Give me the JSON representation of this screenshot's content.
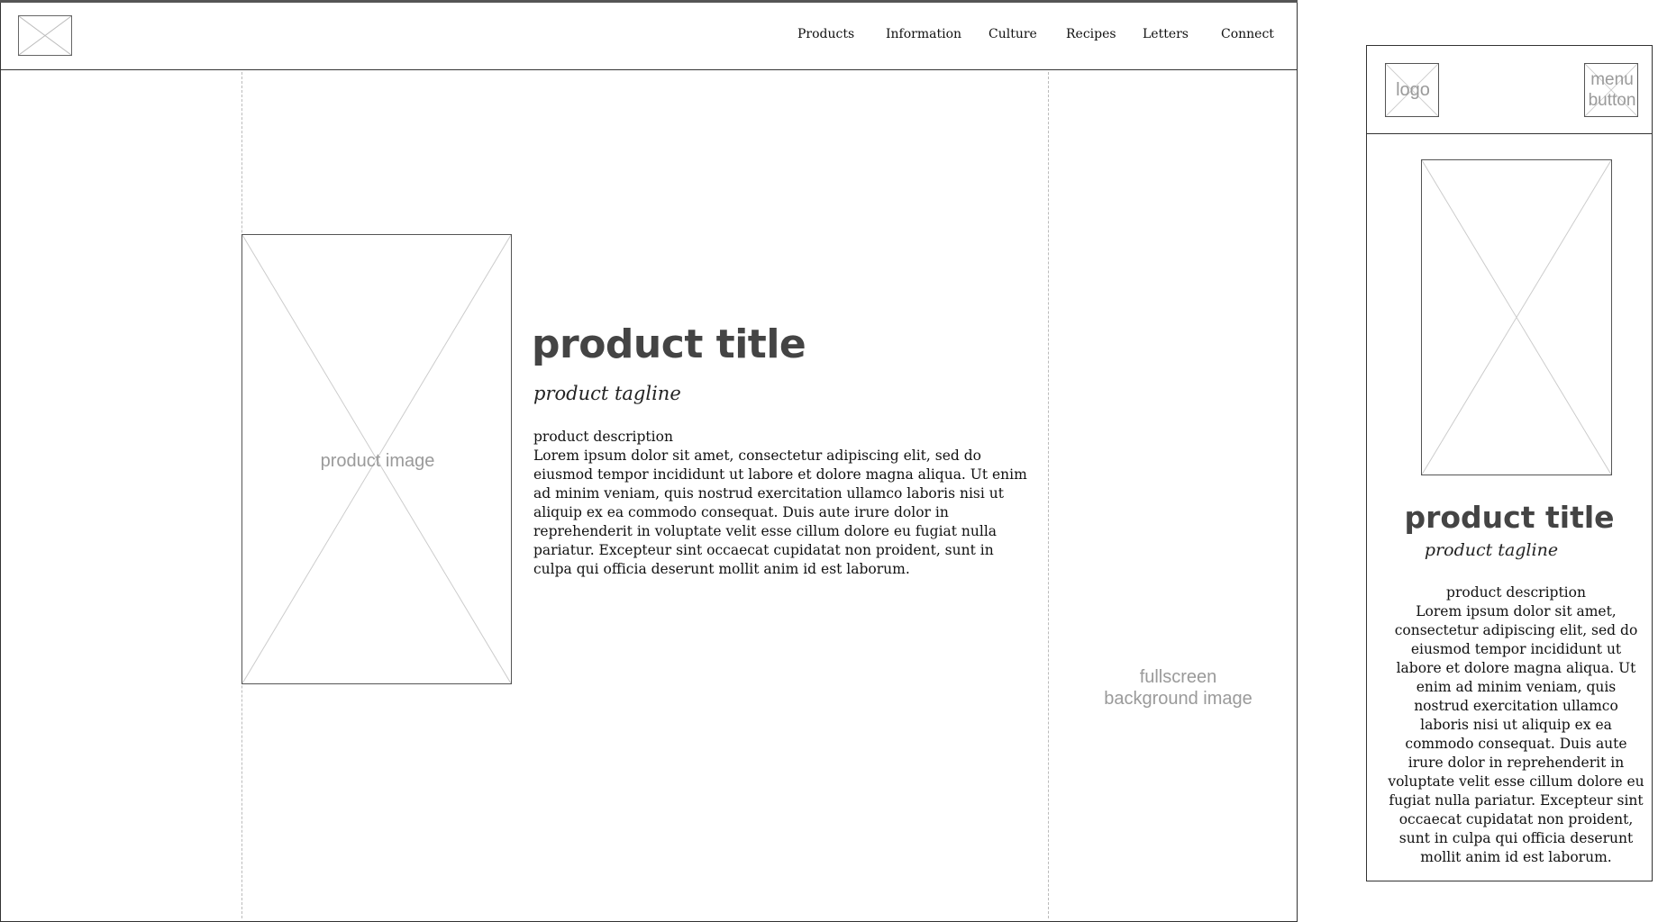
{
  "desktop": {
    "nav": [
      "Products",
      "Information",
      "Culture",
      "Recipes",
      "Letters",
      "Connect"
    ],
    "product_image_label": "product image",
    "title": "product title",
    "tagline": "product tagline",
    "description_heading": "product description",
    "description_body": "Lorem ipsum dolor sit amet, consectetur adipiscing elit, sed do eiusmod tempor incididunt ut labore et dolore magna aliqua. Ut enim ad minim veniam, quis nostrud exercitation ullamco laboris nisi ut aliquip ex ea commodo consequat. Duis aute irure dolor in reprehenderit in voluptate velit esse cillum dolore eu fugiat nulla pariatur. Excepteur sint occaecat cupidatat non proident, sunt in culpa qui officia deserunt mollit anim id est laborum.",
    "background_label_line1": "fullscreen",
    "background_label_line2": "background image"
  },
  "mobile": {
    "logo_label": "logo",
    "menu_label_line1": "menu",
    "menu_label_line2": "button",
    "title": "product title",
    "tagline": "product tagline",
    "description_heading": "product description",
    "description_body": "Lorem ipsum dolor sit amet, consectetur adipiscing elit, sed do eiusmod tempor incididunt ut labore et dolore magna aliqua. Ut enim ad minim veniam, quis nostrud exercitation ullamco laboris nisi ut aliquip ex ea commodo consequat. Duis aute irure dolor in reprehenderit in voluptate velit esse cillum dolore eu fugiat nulla pariatur. Excepteur sint occaecat cupidatat non proident, sunt in culpa qui officia deserunt mollit anim id est laborum."
  }
}
